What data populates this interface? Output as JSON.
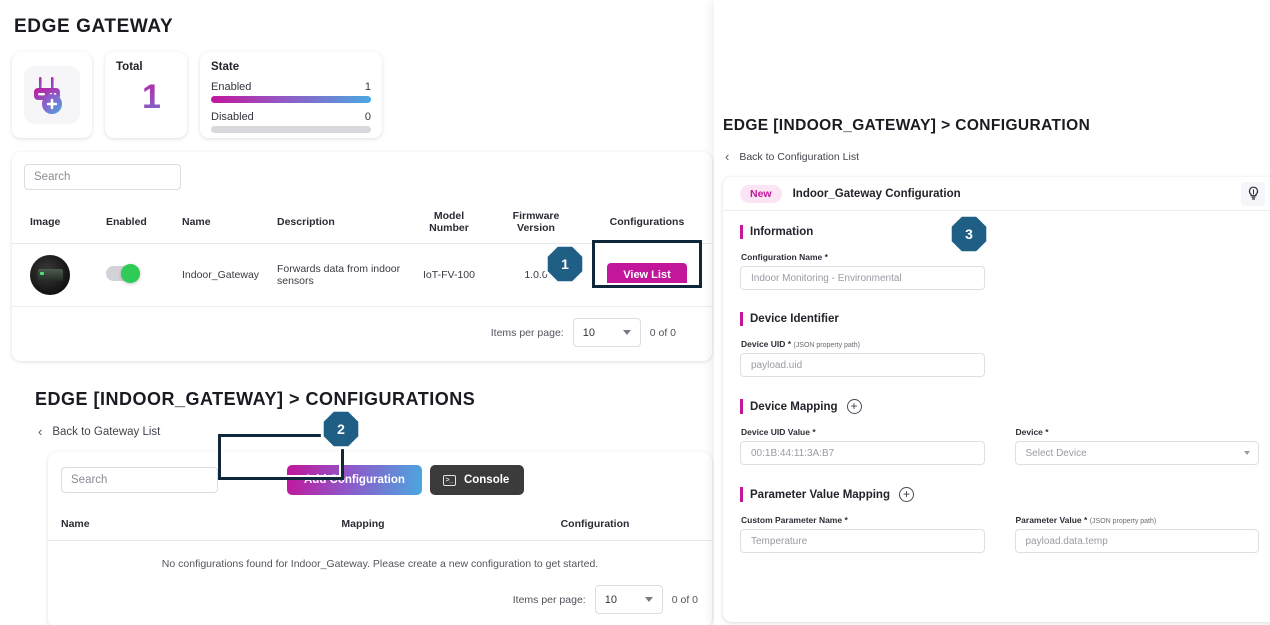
{
  "left": {
    "page_title": "EDGE GATEWAY",
    "cards": {
      "gateway_icon": "edge-gateway-add-icon",
      "total": {
        "label": "Total",
        "value": "1"
      },
      "state": {
        "label": "State",
        "rows": [
          {
            "name": "Enabled",
            "value": "1",
            "percent": 100
          },
          {
            "name": "Disabled",
            "value": "0",
            "percent": 0
          }
        ]
      }
    },
    "search_placeholder": "Search",
    "table": {
      "headers": [
        "Image",
        "Enabled",
        "Name",
        "Description",
        "Model Number",
        "Firmware Version",
        "Configurations"
      ],
      "header_model_line1": "Model",
      "header_model_line2": "Number",
      "header_fw_line1": "Firmware",
      "header_fw_line2": "Version",
      "rows": [
        {
          "name": "Indoor_Gateway",
          "description": "Forwards data from indoor sensors",
          "model_number": "IoT-FV-100",
          "firmware_version": "1.0.0",
          "enabled": true,
          "action_label": "View List"
        }
      ],
      "paginator": {
        "items_per_page_label": "Items per page:",
        "items_per_page_value": "10",
        "range_label": "0 of 0"
      }
    },
    "section2": {
      "title": "EDGE [INDOOR_GATEWAY] > CONFIGURATIONS",
      "back_label": "Back to Gateway List",
      "search_placeholder": "Search",
      "add_button": "Add Configuration",
      "console_button": "Console",
      "headers": [
        "Name",
        "Mapping",
        "Configuration"
      ],
      "empty_message": "No configurations found for Indoor_Gateway. Please create a new configuration to get started.",
      "paginator": {
        "items_per_page_label": "Items per page:",
        "items_per_page_value": "10",
        "range_label": "0 of 0"
      }
    }
  },
  "right": {
    "title": "EDGE [INDOOR_GATEWAY] > CONFIGURATION",
    "back_label": "Back to Configuration List",
    "form_header": {
      "badge": "New",
      "title": "Indoor_Gateway Configuration",
      "bulb_icon": "lightbulb-icon"
    },
    "sections": {
      "information": {
        "title": "Information",
        "config_name_label": "Configuration Name *",
        "config_name_placeholder": "Indoor Monitoring - Environmental"
      },
      "device_identifier": {
        "title": "Device Identifier",
        "uid_label": "Device UID *",
        "uid_hint": "(JSON property path)",
        "uid_placeholder": "payload.uid"
      },
      "device_mapping": {
        "title": "Device Mapping",
        "uid_value_label": "Device UID Value *",
        "uid_value_placeholder": "00:1B:44:11:3A:B7",
        "device_label": "Device *",
        "device_placeholder": "Select Device"
      },
      "parameter_value_mapping": {
        "title": "Parameter Value Mapping",
        "param_name_label": "Custom Parameter Name *",
        "param_name_placeholder": "Temperature",
        "param_value_label": "Parameter Value *",
        "param_value_hint": "(JSON property path)",
        "param_value_placeholder": "payload.data.temp"
      }
    }
  },
  "steps": [
    {
      "number": "1"
    },
    {
      "number": "2"
    },
    {
      "number": "3"
    }
  ],
  "colors": {
    "accent_magenta": "#c2169b",
    "accent_blue": "#4aa8e0",
    "step_badge": "#1f5f85",
    "toggle_on": "#2ecc57",
    "console_dark": "#3b3b3b"
  }
}
